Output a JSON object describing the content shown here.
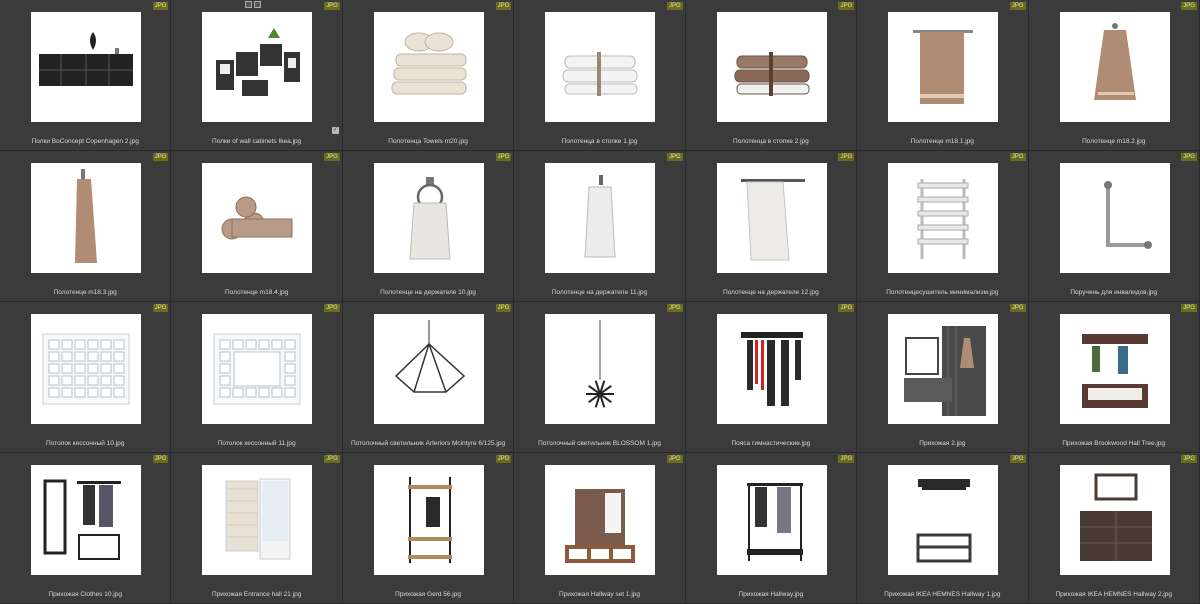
{
  "badge_label": "JPG",
  "check_glyph": "✓",
  "tiles": [
    {
      "label": "Полки BoConcept Copenhagen 2.jpg",
      "icon": "wall-shelf-icon"
    },
    {
      "label": "Полки of wall cabinets Ikea.jpg",
      "icon": "wall-cabinets-icon",
      "selected": true
    },
    {
      "label": "Полотенца Towels m20.jpg",
      "icon": "towel-stack-icon"
    },
    {
      "label": "Полотенца в стопке 1.jpg",
      "icon": "towel-stack-white-icon"
    },
    {
      "label": "Полотенца в стопке 2.jpg",
      "icon": "towel-stack-brown-icon"
    },
    {
      "label": "Полотенце m18.1.jpg",
      "icon": "towel-bar-icon"
    },
    {
      "label": "Полотенце m18.2.jpg",
      "icon": "hanging-towel-icon"
    },
    {
      "label": "Полотенце m18.3.jpg",
      "icon": "hanging-towel-long-icon"
    },
    {
      "label": "Полотенце m18.4.jpg",
      "icon": "rolled-towels-icon"
    },
    {
      "label": "Полотенце на держателе 10.jpg",
      "icon": "towel-ring-icon"
    },
    {
      "label": "Полотенце на держателе 11.jpg",
      "icon": "towel-hook-icon"
    },
    {
      "label": "Полотенце на держателе 12.jpg",
      "icon": "towel-rail-icon"
    },
    {
      "label": "Полотенцесушитель минимализм.jpg",
      "icon": "towel-dryer-icon"
    },
    {
      "label": "Поручень для инвалидов.jpg",
      "icon": "grab-bar-icon"
    },
    {
      "label": "Потолок кессонный 10.jpg",
      "icon": "coffered-ceiling-icon"
    },
    {
      "label": "Потолок кессонный 11.jpg",
      "icon": "coffered-ceiling-frame-icon"
    },
    {
      "label": "Потолочный светильник Arteriors Mcintyre 6/125.jpg",
      "icon": "chandelier-icon"
    },
    {
      "label": "Потолочный светильник BLOSSOM 1.jpg",
      "icon": "pendant-lamp-icon"
    },
    {
      "label": "Пояса гимнастические.jpg",
      "icon": "gym-belts-icon"
    },
    {
      "label": "Прихожая 2.jpg",
      "icon": "hallway-set-icon"
    },
    {
      "label": "Прихожая Brookwood Hall Tree.jpg",
      "icon": "hall-tree-icon"
    },
    {
      "label": "Прихожая Clothes 10.jpg",
      "icon": "hallway-clothes-icon"
    },
    {
      "label": "Прихожая Entrance hall 21.jpg",
      "icon": "entrance-hall-icon"
    },
    {
      "label": "Прихожая Gerd 56.jpg",
      "icon": "coat-stand-icon"
    },
    {
      "label": "Прихожая Hallway set 1.jpg",
      "icon": "hallway-bench-icon"
    },
    {
      "label": "Прихожая Hallway.jpg",
      "icon": "clothes-rack-icon"
    },
    {
      "label": "Прихожая IKEA HEMNES Hallway 1.jpg",
      "icon": "hat-shelf-bench-icon"
    },
    {
      "label": "Прихожая IKEA HEMNES Hallway 2.jpg",
      "icon": "shoe-cabinet-mirror-icon"
    }
  ]
}
